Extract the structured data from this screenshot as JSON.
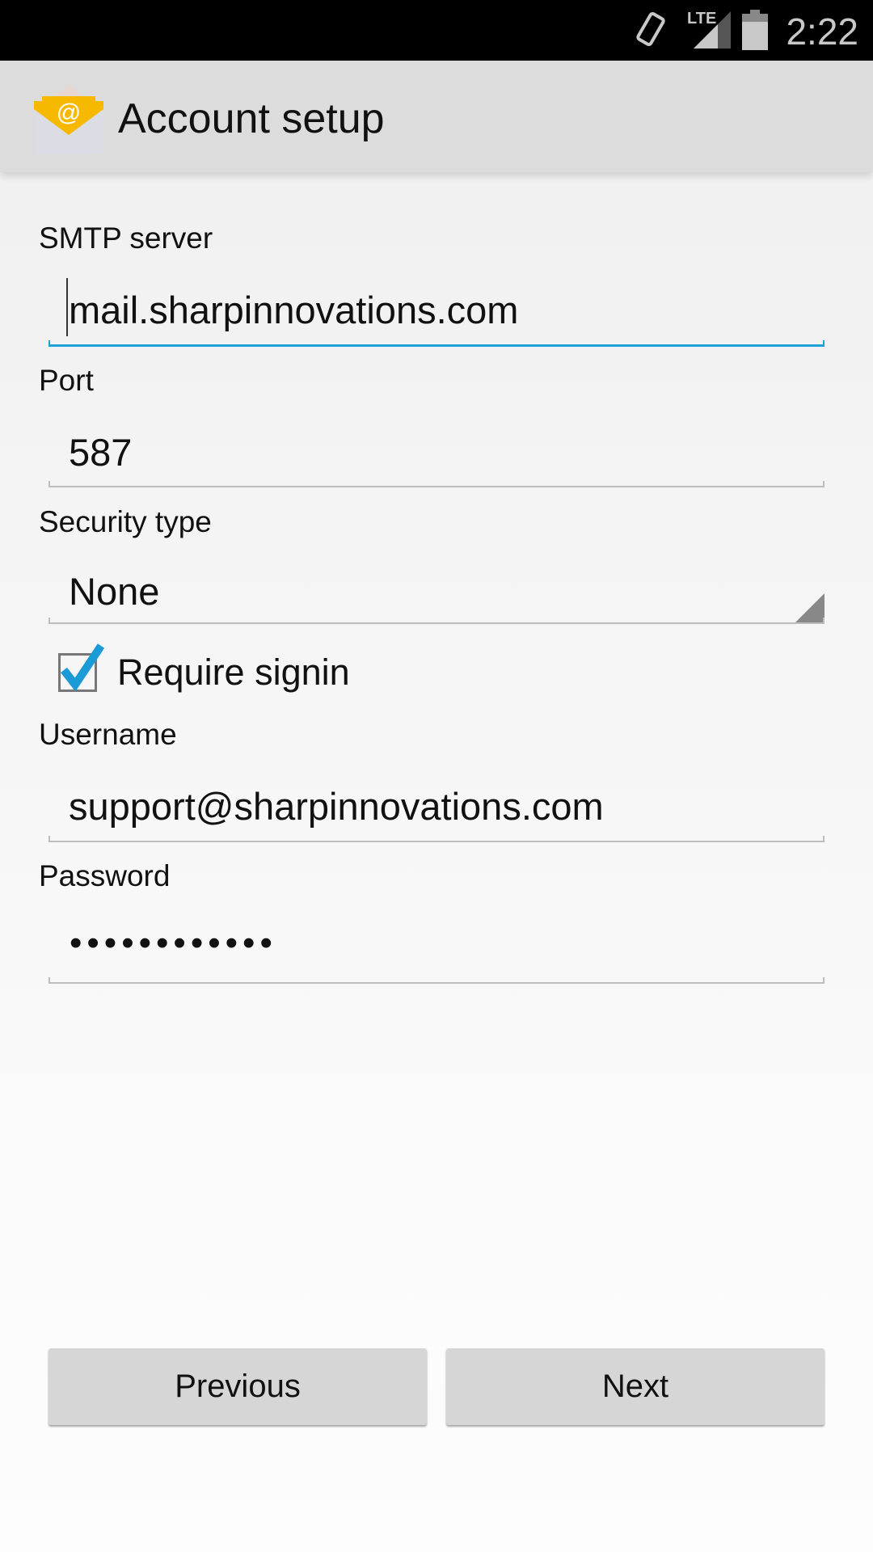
{
  "status_bar": {
    "time": "2:22",
    "network": "LTE",
    "icons": [
      "vibrate-icon",
      "lte-signal-icon",
      "battery-icon"
    ]
  },
  "header": {
    "title": "Account setup",
    "icon": "email-app-icon"
  },
  "form": {
    "smtp_label": "SMTP server",
    "smtp_value": "mail.sharpinnovations.com",
    "port_label": "Port",
    "port_value": "587",
    "security_label": "Security type",
    "security_value": "None",
    "require_signin_label": "Require signin",
    "require_signin_checked": true,
    "username_label": "Username",
    "username_value": "support@sharpinnovations.com",
    "password_label": "Password",
    "password_value": "••••••••••••"
  },
  "buttons": {
    "previous": "Previous",
    "next": "Next"
  },
  "colors": {
    "accent": "#1ea1d6",
    "header_bg": "#dcdcdc"
  }
}
